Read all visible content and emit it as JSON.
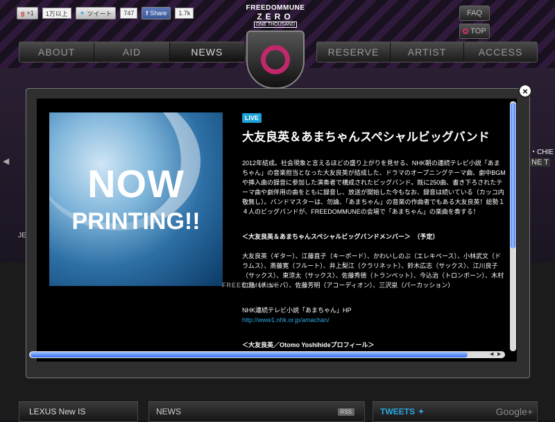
{
  "social": {
    "gplus_label": "+1",
    "gplus_count": "1万以上",
    "tweet_label": "ツイート",
    "tweet_count": "747",
    "share_label": "Share",
    "share_count": "1.7k"
  },
  "logo": {
    "line1": "FREEDOMMUNE",
    "line2": "ZERO",
    "line3": "ONE THOUSAND"
  },
  "top_buttons": {
    "faq": "FAQ",
    "top": "TOP"
  },
  "nav_left": [
    "ABOUT",
    "AID",
    "NEWS"
  ],
  "nav_right": [
    "RESERVE",
    "ARTIST",
    "ACCESS"
  ],
  "nav_active": "NEWS",
  "hero": {
    "side_text": "・CHIE",
    "side_text2": "NE T",
    "left_text": "JE"
  },
  "bottom": {
    "lexus": "LEXUS New IS",
    "news": "NEWS",
    "rss": "RSS",
    "tweets": "TWEETS",
    "google": "Google+"
  },
  "modal": {
    "image_line1": "NOW",
    "image_line2": "PRINTING!!",
    "badge": "LIVE",
    "title": "大友良英＆あまちゃんスペシャルビッグバンド",
    "description": "2012年結成。社会現象と言えるほどの盛り上がりを見せる、NHK朝の連続テレビ小説「あまちゃん」の音楽担当となった大友良英が結成した、ドラマのオープニングテーマ曲、劇中BGMや挿入曲の録音に参加した演奏者で構成されたビッグバンド。既に250曲、書き下ろされたテーマ曲や劇伴用の曲をともに録音し、放送が開始した今もなお、録音は続いている（カッコ内敬無し）。バンドマスターは、勿論、「あまちゃん」の音楽の作曲者でもある大友良英！総勢１４人のビッグバンドが、FREEDOMMUNEの会場で「あまちゃん」の楽曲を奏する！",
    "members_heading": "＜大友良英＆あまちゃんスペシャルビッグバンドメンバー＞　（予定）",
    "members": "大友良英（ギター）、江藤直子（キーボード）、かわいしのぶ（エレキベース）、小林武文（ドラムス）、斎藤寛（フルート）、井上梨江（クラリネット）、鈴木広志（サックス）、江川良子（サックス）、東涼太（サックス）、佐藤秀徳（トランペット）、今込治（トロンボーン）、木村仁哉（チューバ）、佐藤芳明（アコーディオン）、三沢泉（パーカッション）",
    "hp_label": "NHK連続テレビ小説「あまちゃん」HP",
    "hp_url": "http://www1.nhk.or.jp/amachan/",
    "profile_heading": "＜大友良英／Otomo Yoshihideプロフィール＞",
    "footer": "FREEDOMMUNE"
  },
  "colors": {
    "accent_pink": "#c0286a",
    "live_badge": "#1aa0d8",
    "link": "#2aa6e0"
  }
}
